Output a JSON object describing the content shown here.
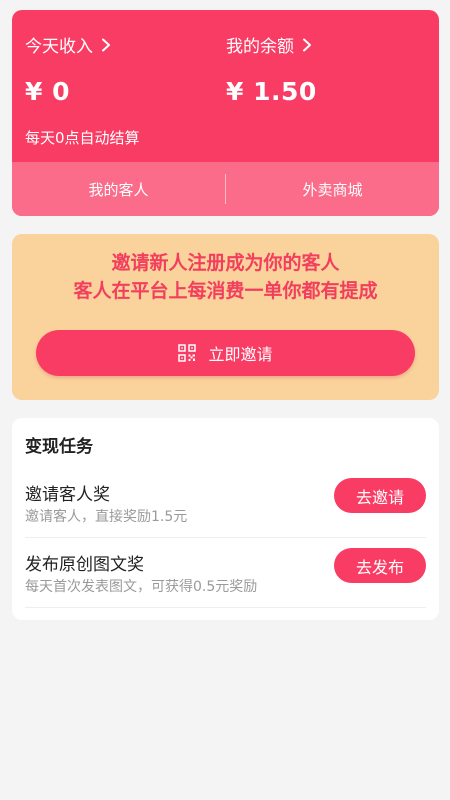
{
  "earnings": {
    "today_label": "今天收入",
    "today_value": "¥ 0",
    "balance_label": "我的余额",
    "balance_value": "¥ 1.50",
    "note": "每天0点自动结算",
    "tabs": [
      "我的客人",
      "外卖商城"
    ]
  },
  "invite": {
    "line1": "邀请新人注册成为你的客人",
    "line2": "客人在平台上每消费一单你都有提成",
    "button_label": "立即邀请",
    "icon": "qr-code-icon"
  },
  "tasks": {
    "title": "变现任务",
    "items": [
      {
        "name": "邀请客人奖",
        "desc": "邀请客人，直接奖励1.5元",
        "button": "去邀请"
      },
      {
        "name": "发布原创图文奖",
        "desc": "每天首次发表图文，可获得0.5元奖励",
        "button": "去发布"
      }
    ]
  },
  "colors": {
    "primary": "#f93c64",
    "tab_bar": "#fb6b8a",
    "banner": "#fad29c",
    "background": "#f4f4f4"
  }
}
